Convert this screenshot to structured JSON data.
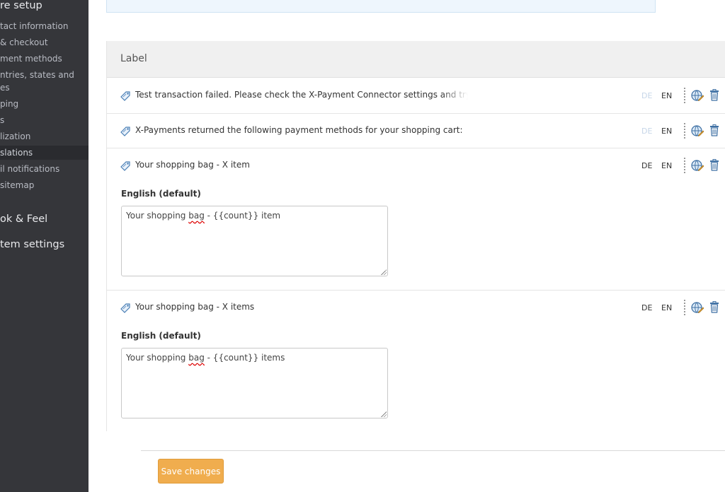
{
  "sidebar": {
    "store_setup_heading": "re setup",
    "items": [
      {
        "label": "tact information"
      },
      {
        "label": "& checkout"
      },
      {
        "label": "ment methods"
      },
      {
        "label": "ntries, states and"
      },
      {
        "label": "es"
      },
      {
        "label": "ping"
      },
      {
        "label": "s"
      },
      {
        "label": "lization"
      },
      {
        "label": "slations"
      },
      {
        "label": "il notifications"
      },
      {
        "label": "sitemap"
      }
    ],
    "look_feel_heading": "ok & Feel",
    "system_settings_heading": "tem settings"
  },
  "table": {
    "column_header": "Label",
    "rows": [
      {
        "label": "Test transaction failed. Please check the X-Payment Connector settings and try agair",
        "lang_de": "DE",
        "lang_en": "EN",
        "de_missing": true
      },
      {
        "label": "X-Payments returned the following payment methods for your shopping cart:",
        "lang_de": "DE",
        "lang_en": "EN",
        "de_missing": true
      },
      {
        "label": "Your shopping bag - X item",
        "lang_de": "DE",
        "lang_en": "EN",
        "de_missing": false,
        "field_label": "English (default)",
        "value_before": "Your shopping ",
        "value_misspelled": "bag",
        "value_after": " - {{count}} item"
      },
      {
        "label": "Your shopping bag - X items",
        "lang_de": "DE",
        "lang_en": "EN",
        "de_missing": false,
        "field_label": "English (default)",
        "value_before": "Your shopping ",
        "value_misspelled": "bag",
        "value_after": " - {{count}} items"
      }
    ]
  },
  "footer": {
    "save_label": "Save changes"
  },
  "colors": {
    "sidebar_bg": "#35363a",
    "accent_button": "#f0ad4e",
    "info_box_bg": "#eef6fd",
    "missing_lang": "#c6d6e8"
  },
  "icons": {
    "row_icon": "tag-icon",
    "translate_icon": "globe-pencil-icon",
    "delete_icon": "trash-icon"
  }
}
